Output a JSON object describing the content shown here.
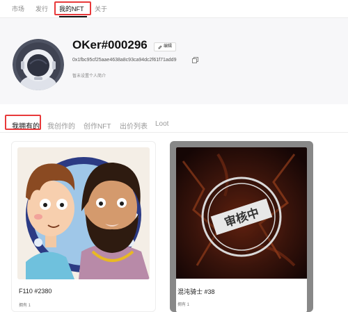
{
  "nav": {
    "items": [
      {
        "label": "市场"
      },
      {
        "label": "发行"
      },
      {
        "label": "我的NFT"
      },
      {
        "label": "关于"
      }
    ]
  },
  "profile": {
    "username": "OKer#000296",
    "edit_label": "编辑",
    "address": "0x1fbc95cf25aae4638a8c93ca94dc2f61f71add9",
    "bio": "暂未设置个人简介"
  },
  "tabs": [
    {
      "label": "我拥有的"
    },
    {
      "label": "我创作的"
    },
    {
      "label": "创作NFT"
    },
    {
      "label": "出价列表"
    },
    {
      "label": "Loot"
    }
  ],
  "cards": [
    {
      "title": "F110 #2380",
      "owned": "拥有 1"
    },
    {
      "title": "混沌骑士 #38",
      "owned": "拥有 1",
      "stamp": "审核中"
    }
  ],
  "colors": {
    "highlight_box": "#e8393a",
    "profile_background": "#f7f7f9",
    "nft_ring": "#2c3b84"
  },
  "icons": [
    "edit-icon",
    "copy-icon"
  ]
}
